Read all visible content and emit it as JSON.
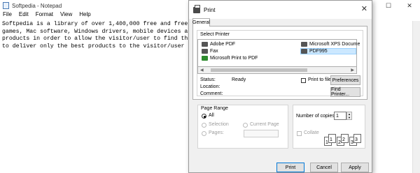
{
  "notepad": {
    "title": "Softpedia - Notepad",
    "caption": {
      "min": "─",
      "max": "☐",
      "close": "✕"
    },
    "menu": [
      "File",
      "Edit",
      "Format",
      "View",
      "Help"
    ],
    "lines": [
      "Softpedia is a library of over 1,400,000 free and free-to",
      "games, Mac software, Windows drivers, mobile devices and",
      "products in order to allow the visitor/user to find the e",
      "to deliver only the best products to the visitor/user tog"
    ]
  },
  "dialog": {
    "title": "Print",
    "close": "✕",
    "tab": "General",
    "select_printer_label": "Select Printer",
    "printers": [
      {
        "name": "Adobe PDF",
        "icon": "printer-icon",
        "selected": false
      },
      {
        "name": "Fax",
        "icon": "fax-icon",
        "selected": false
      },
      {
        "name": "Microsoft Print to PDF",
        "icon": "default-printer-icon",
        "selected": false
      },
      {
        "name": "Microsoft XPS Docume",
        "icon": "printer-icon",
        "selected": false
      },
      {
        "name": "PDF995",
        "icon": "printer-icon",
        "selected": true
      }
    ],
    "status_label": "Status:",
    "status_value": "Ready",
    "location_label": "Location:",
    "comment_label": "Comment:",
    "print_to_file": "Print to file",
    "preferences": "Preferences",
    "find_printer": "Find Printer...",
    "page_range_label": "Page Range",
    "range_all": "All",
    "range_selection": "Selection",
    "range_current": "Current Page",
    "range_pages": "Pages:",
    "copies_label": "Number of copies:",
    "copies_value": "1",
    "collate": "Collate",
    "collate_pages": [
      "1",
      "1",
      "2",
      "2",
      "3",
      "3"
    ],
    "buttons": {
      "print": "Print",
      "cancel": "Cancel",
      "apply": "Apply"
    }
  }
}
